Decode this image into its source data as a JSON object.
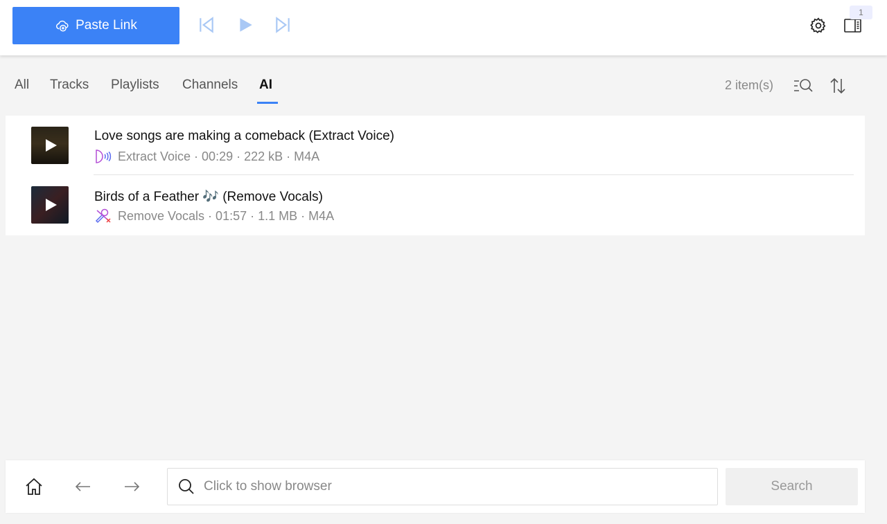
{
  "topbar": {
    "paste_label": "Paste Link",
    "badge_count": "1"
  },
  "tabs": [
    {
      "label": "All",
      "active": false
    },
    {
      "label": "Tracks",
      "active": false
    },
    {
      "label": "Playlists",
      "active": false
    },
    {
      "label": "Channels",
      "active": false
    },
    {
      "label": "AI",
      "active": true
    }
  ],
  "list_header": {
    "item_count": "2 item(s)"
  },
  "items": [
    {
      "title": "Love songs are making a comeback (Extract Voice)",
      "meta": "Extract Voice · 00:29 · 222 kB · M4A",
      "type_icon": "extract-voice-icon"
    },
    {
      "title": "Birds of a Feather 🎶 (Remove Vocals)",
      "meta": "Remove Vocals · 01:57 · 1.1 MB · M4A",
      "type_icon": "remove-vocals-icon"
    }
  ],
  "bottombar": {
    "search_placeholder": "Click to show browser",
    "search_button": "Search"
  },
  "colors": {
    "accent": "#3b82f6",
    "transport_disabled": "#a9c8f5",
    "background": "#f4f4f4"
  }
}
